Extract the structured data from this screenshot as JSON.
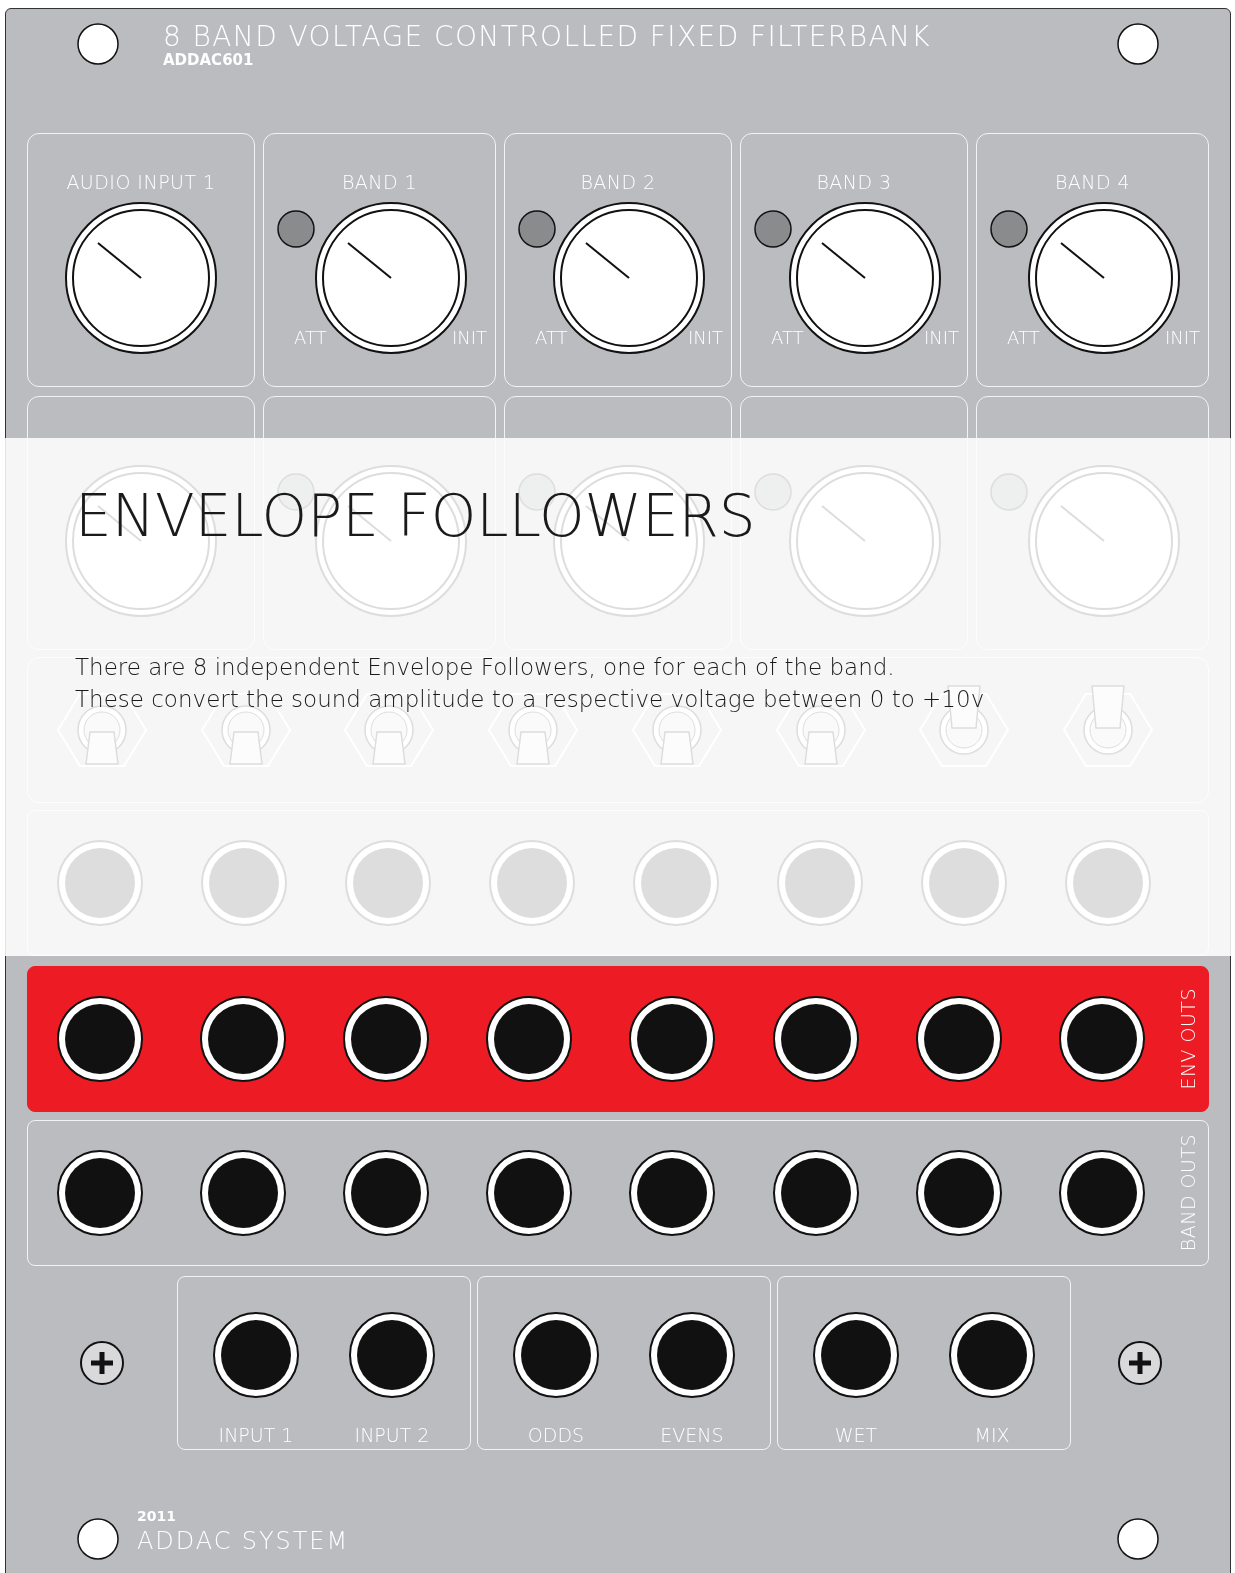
{
  "panel": {
    "title": "8 BAND VOLTAGE CONTROLLED FIXED FILTERBANK",
    "model": "ADDAC601"
  },
  "knob_rows": [
    [
      {
        "kind": "input",
        "label": "AUDIO INPUT 1"
      },
      {
        "kind": "band",
        "label": "BAND 1",
        "left": "ATT",
        "right": "INIT"
      },
      {
        "kind": "band",
        "label": "BAND 2",
        "left": "ATT",
        "right": "INIT"
      },
      {
        "kind": "band",
        "label": "BAND 3",
        "left": "ATT",
        "right": "INIT"
      },
      {
        "kind": "band",
        "label": "BAND 4",
        "left": "ATT",
        "right": "INIT"
      }
    ],
    [
      {
        "kind": "input"
      },
      {
        "kind": "band"
      },
      {
        "kind": "band"
      },
      {
        "kind": "band"
      },
      {
        "kind": "band"
      }
    ]
  ],
  "switch_row": {
    "switches": [
      {
        "on": false
      },
      {
        "on": false
      },
      {
        "on": false
      },
      {
        "on": false
      },
      {
        "on": false
      },
      {
        "on": false
      },
      {
        "on": true
      },
      {
        "on": true
      }
    ]
  },
  "jack_rows": [
    {
      "highlighted": false
    },
    {
      "label": "ENV OUTS",
      "highlighted": true
    },
    {
      "label": "BAND OUTS",
      "highlighted": false
    }
  ],
  "io_groups": [
    {
      "labels": [
        "INPUT 1",
        "INPUT 2"
      ]
    },
    {
      "labels": [
        "ODDS",
        "EVENS"
      ]
    },
    {
      "labels": [
        "WET",
        "MIX"
      ]
    }
  ],
  "footer": {
    "year": "2011",
    "brand": "ADDAC SYSTEM"
  },
  "overlay": {
    "title": "ENVELOPE FOLLOWERS",
    "lines": [
      "There are 8 independent Envelope Followers, one for each of the band.",
      "These convert the sound amplitude to a respective voltage between 0 to +10v"
    ]
  }
}
